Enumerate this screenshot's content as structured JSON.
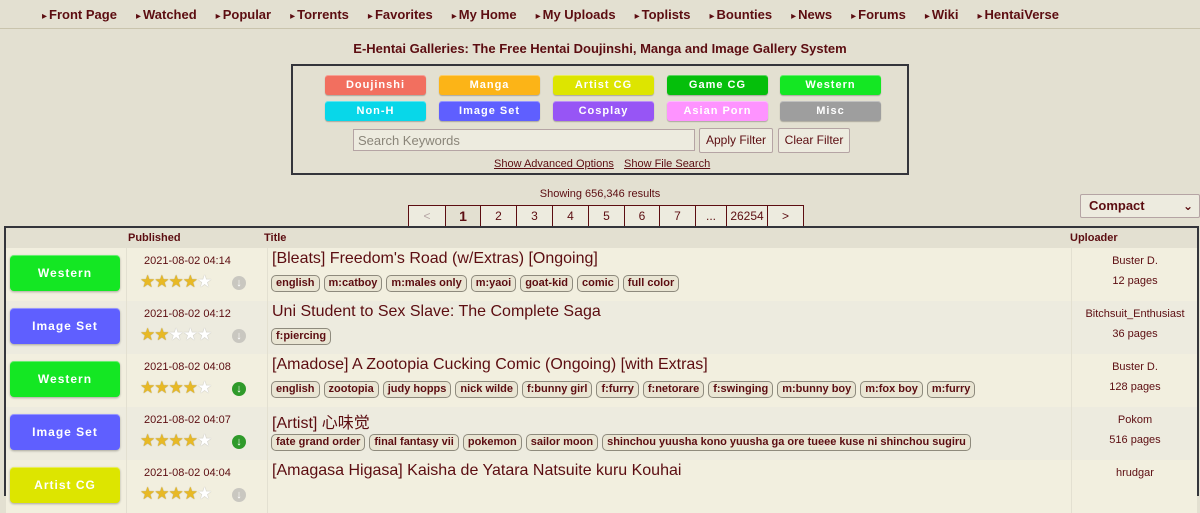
{
  "nav": [
    "Front Page",
    "Watched",
    "Popular",
    "Torrents",
    "Favorites",
    "My Home",
    "My Uploads",
    "Toplists",
    "Bounties",
    "News",
    "Forums",
    "Wiki",
    "HentaiVerse"
  ],
  "site_title": "E-Hentai Galleries: The Free Hentai Doujinshi, Manga and Image Gallery System",
  "categories": [
    {
      "label": "Doujinshi",
      "color": "#f26f5f"
    },
    {
      "label": "Manga",
      "color": "#fcb417"
    },
    {
      "label": "Artist CG",
      "color": "#dde500"
    },
    {
      "label": "Game CG",
      "color": "#05bf0b"
    },
    {
      "label": "Western",
      "color": "#14e723"
    },
    {
      "label": "Non-H",
      "color": "#08d7e9"
    },
    {
      "label": "Image Set",
      "color": "#5f5fff"
    },
    {
      "label": "Cosplay",
      "color": "#9755f5"
    },
    {
      "label": "Asian Porn",
      "color": "#fe93ff"
    },
    {
      "label": "Misc",
      "color": "#9e9e9e"
    }
  ],
  "search": {
    "placeholder": "Search Keywords",
    "apply_label": "Apply Filter",
    "clear_label": "Clear Filter",
    "advanced_label": "Show Advanced Options",
    "file_search_label": "Show File Search"
  },
  "results_text": "Showing 656,346 results",
  "pager": [
    "<",
    "1",
    "2",
    "3",
    "4",
    "5",
    "6",
    "7",
    "...",
    "26254",
    ">"
  ],
  "pager_current": "1",
  "display_mode": "Compact",
  "table_headers": {
    "published": "Published",
    "title": "Title",
    "uploader": "Uploader"
  },
  "galleries": [
    {
      "category": "Western",
      "cat_color": "#14e723",
      "published": "2021-08-02 04:14",
      "rating": 4,
      "torrent": false,
      "title": "[Bleats] Freedom's Road (w/Extras) [Ongoing]",
      "tags": [
        "english",
        "m:catboy",
        "m:males only",
        "m:yaoi",
        "goat-kid",
        "comic",
        "full color"
      ],
      "uploader": "Buster D.",
      "pages": "12 pages"
    },
    {
      "category": "Image Set",
      "cat_color": "#5f5fff",
      "published": "2021-08-02 04:12",
      "rating": 2,
      "torrent": false,
      "title": "Uni Student to Sex Slave: The Complete Saga",
      "tags": [
        "f:piercing"
      ],
      "uploader": "Bitchsuit_Enthusiast",
      "pages": "36 pages"
    },
    {
      "category": "Western",
      "cat_color": "#14e723",
      "published": "2021-08-02 04:08",
      "rating": 4,
      "torrent": true,
      "title": "[Amadose] A Zootopia Cucking Comic (Ongoing) [with Extras]",
      "tags": [
        "english",
        "zootopia",
        "judy hopps",
        "nick wilde",
        "f:bunny girl",
        "f:furry",
        "f:netorare",
        "f:swinging",
        "m:bunny boy",
        "m:fox boy",
        "m:furry"
      ],
      "uploader": "Buster D.",
      "pages": "128 pages"
    },
    {
      "category": "Image Set",
      "cat_color": "#5f5fff",
      "published": "2021-08-02 04:07",
      "rating": 4,
      "torrent": true,
      "title": "[Artist] 心味觉",
      "tags": [
        "fate grand order",
        "final fantasy vii",
        "pokemon",
        "sailor moon",
        "shinchou yuusha kono yuusha ga ore tueee kuse ni shinchou sugiru"
      ],
      "uploader": "Pokom",
      "pages": "516 pages"
    },
    {
      "category": "Artist CG",
      "cat_color": "#dde500",
      "published": "2021-08-02 04:04",
      "rating": 4,
      "torrent": false,
      "title": "[Amagasa Higasa] Kaisha de Yatara Natsuite kuru Kouhai",
      "tags": [],
      "uploader": "hrudgar",
      "pages": ""
    }
  ]
}
